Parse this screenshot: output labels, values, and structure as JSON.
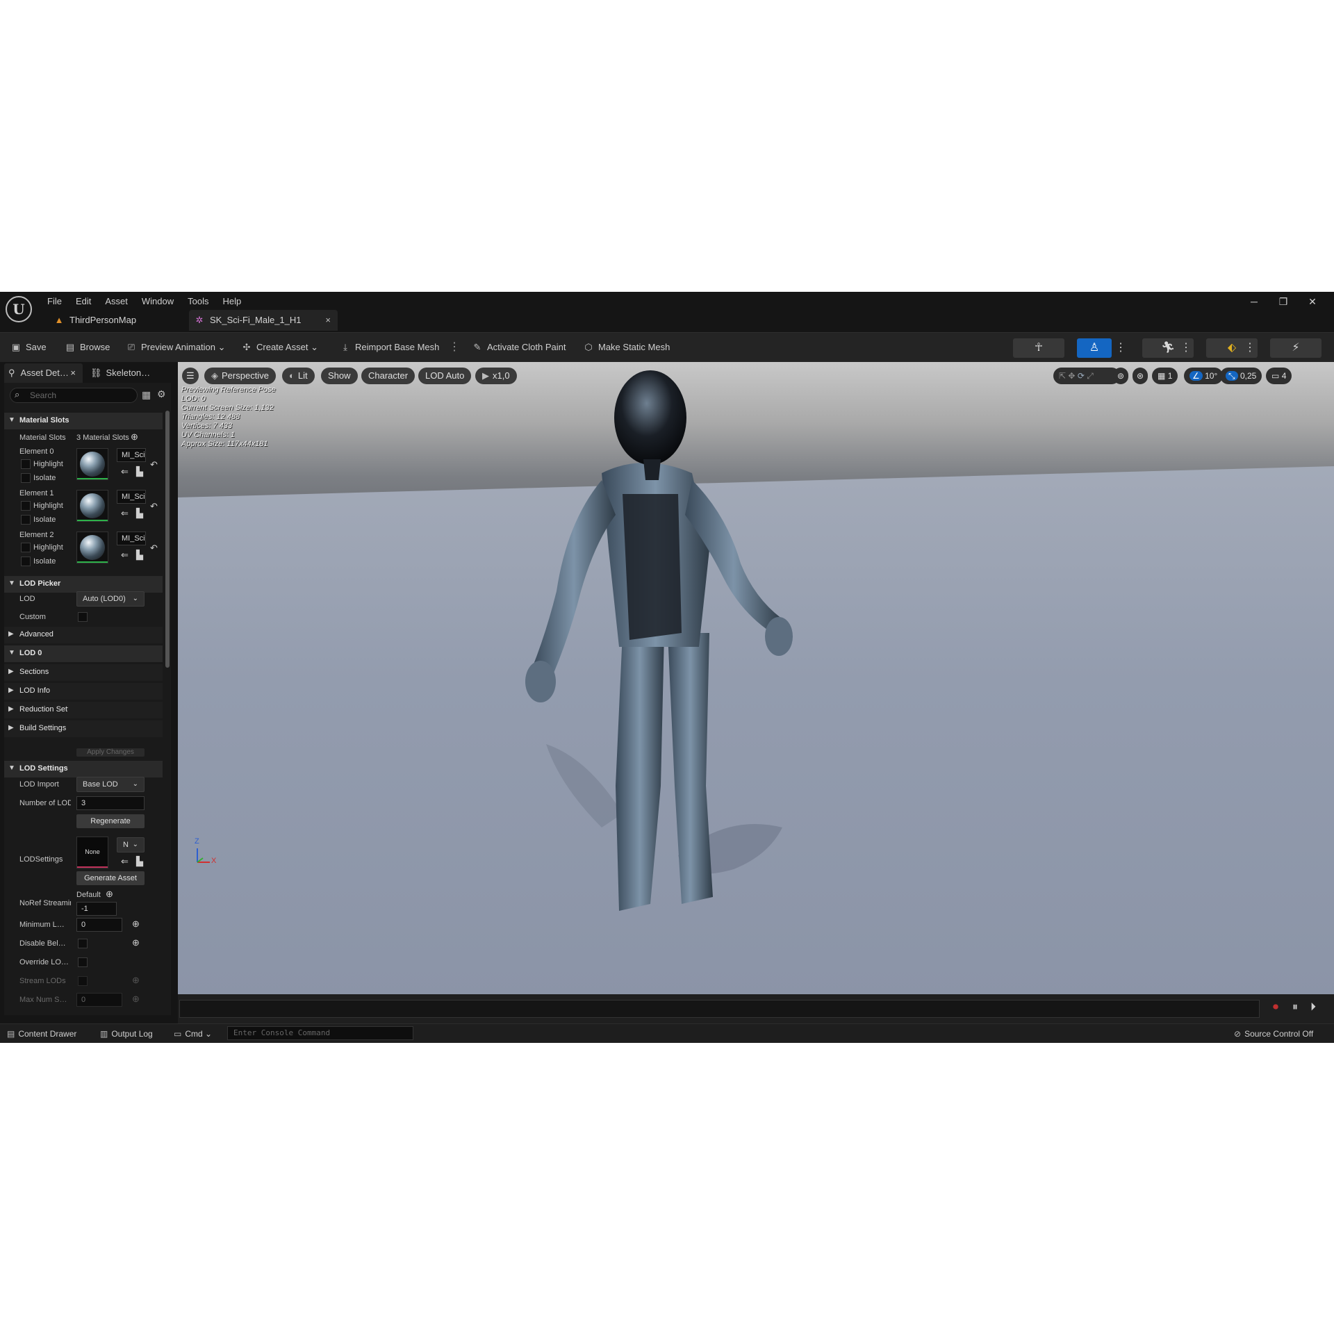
{
  "menu": [
    "File",
    "Edit",
    "Asset",
    "Window",
    "Tools",
    "Help"
  ],
  "window_controls": [
    "─",
    "❐",
    "✕"
  ],
  "tabs": [
    {
      "label": "ThirdPersonMap",
      "icon": "level-icon"
    },
    {
      "label": "SK_Sci-Fi_Male_1_H1",
      "icon": "skeletal-mesh-icon",
      "close": "×"
    }
  ],
  "toolbar": {
    "save": "Save",
    "browse": "Browse",
    "preview_animation": "Preview Animation",
    "create_asset": "Create Asset",
    "reimport": "Reimport Base Mesh",
    "cloth_paint": "Activate Cloth Paint",
    "static_mesh": "Make Static Mesh"
  },
  "left_panel": {
    "tab_details": "Asset Det…",
    "tab_details_close": "×",
    "tab_skeleton": "Skeleton…",
    "search_placeholder": "Search",
    "material_slots_header": "Material Slots",
    "material_slots_label": "Material Slots",
    "material_slots_value": "3 Material Slots",
    "elements": [
      {
        "label": "Element 0",
        "highlight": "Highlight",
        "isolate": "Isolate",
        "material": "MI_Sci"
      },
      {
        "label": "Element 1",
        "highlight": "Highlight",
        "isolate": "Isolate",
        "material": "MI_Sci"
      },
      {
        "label": "Element 2",
        "highlight": "Highlight",
        "isolate": "Isolate",
        "material": "MI_Sci"
      }
    ],
    "lod_picker_header": "LOD Picker",
    "lod_label": "LOD",
    "lod_value": "Auto (LOD0)",
    "custom_label": "Custom",
    "advanced_label": "Advanced",
    "lod0_header": "LOD 0",
    "sections_label": "Sections",
    "lod_info_label": "LOD Info",
    "reduction_label": "Reduction Settings",
    "build_label": "Build Settings",
    "apply_changes": "Apply Changes",
    "lod_settings_header": "LOD Settings",
    "lod_import_label": "LOD Import",
    "lod_import_value": "Base LOD",
    "num_lods_label": "Number of LODs",
    "num_lods_value": "3",
    "regenerate": "Regenerate",
    "lodsettings_label": "LODSettings",
    "lodsettings_thumb": "None",
    "lodsettings_drop": "N",
    "generate_asset": "Generate Asset",
    "noref_label": "NoRef Streaming",
    "noref_default": "Default",
    "noref_value": "-1",
    "min_lod_label": "Minimum L…",
    "min_lod_value": "0",
    "disable_below_label": "Disable Bel…",
    "override_lod_label": "Override LO…",
    "stream_lods_label": "Stream LODs",
    "max_num_label": "Max Num S…",
    "max_num_value": "0"
  },
  "viewport": {
    "perspective": "Perspective",
    "lit": "Lit",
    "show": "Show",
    "character": "Character",
    "lod_auto": "LOD Auto",
    "speed": "x1,0",
    "grid_value": "1",
    "angle_value": "10°",
    "scale_value": "0,25",
    "camera_value": "4",
    "stats": [
      "Previewing Reference Pose",
      "LOD: 0",
      "Current Screen Size: 1,132",
      "Triangles: 12 488",
      "Vertices: 7 433",
      "UV Channels: 1",
      "Approx Size: 117x44x181"
    ],
    "axis_z": "Z",
    "axis_x": "X"
  },
  "statusbar": {
    "content_drawer": "Content Drawer",
    "output_log": "Output Log",
    "cmd": "Cmd",
    "console_placeholder": "Enter Console Command",
    "source_control": "Source Control Off"
  },
  "colors": {
    "accent_blue": "#1466c2",
    "thumbnail_green": "#2db34a",
    "record_red": "#c03030"
  }
}
